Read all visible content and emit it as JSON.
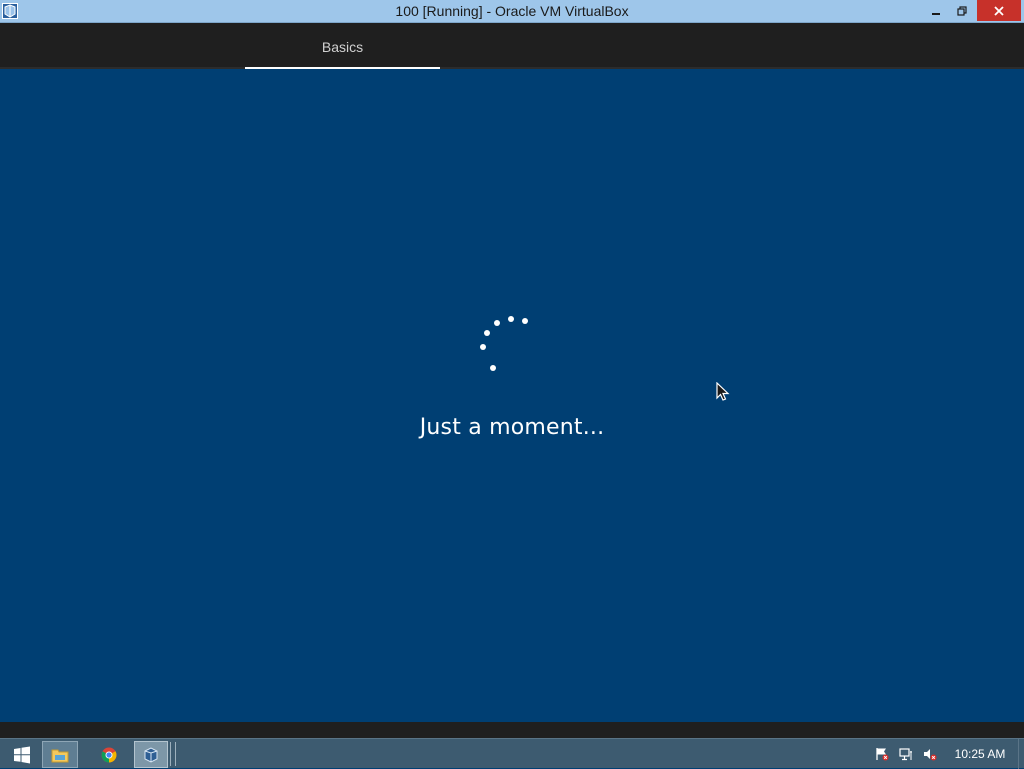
{
  "window": {
    "title": "100 [Running] - Oracle VM VirtualBox",
    "app_icon": "virtualbox-icon",
    "controls": [
      "minimize-icon",
      "restore-icon",
      "close-icon"
    ]
  },
  "tabs": [
    {
      "label": "Basics",
      "active": true
    }
  ],
  "setup": {
    "message": "Just a moment...",
    "spinner_icon": "loading-spinner-icon"
  },
  "taskbar": {
    "items": [
      "windows-start-icon",
      "file-explorer-icon",
      "chrome-icon",
      "virtualbox-icon"
    ],
    "tray_icons": [
      "action-center-flag-icon",
      "network-icon",
      "volume-muted-icon"
    ],
    "clock": "10:25 AM"
  },
  "colors": {
    "background": "#003f73",
    "titlebar": "#9ec6ea",
    "tabbar": "#1f1f1f",
    "taskbar": "#3d5b70",
    "close_button": "#c7312a"
  }
}
